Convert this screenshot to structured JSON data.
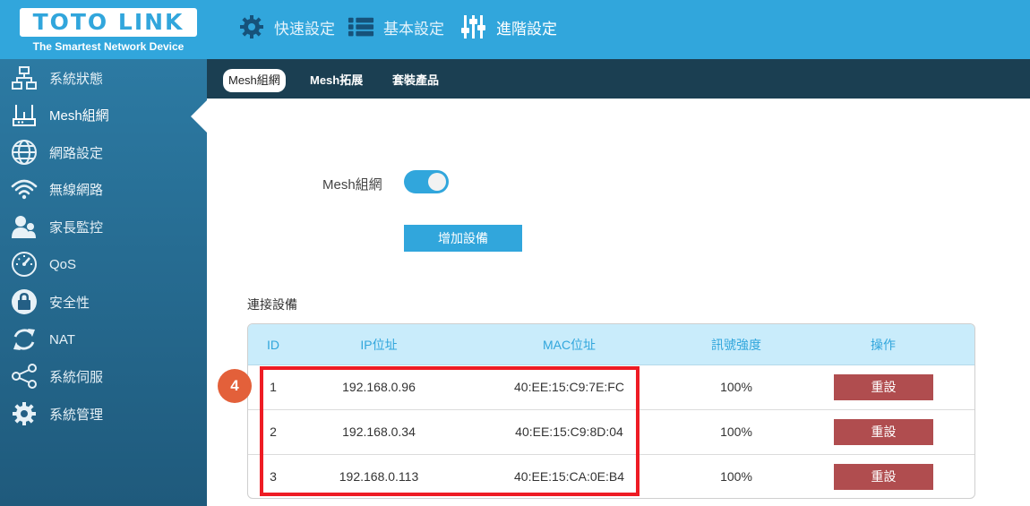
{
  "brand": {
    "logo_text": "TOTO LINK",
    "tagline": "The Smartest Network Device",
    "color_primary": "#31a6dc",
    "color_header_dark": "#1b3f52",
    "color_reset": "#b04d4f"
  },
  "topnav": [
    {
      "label": "快速設定",
      "icon": "gear-icon"
    },
    {
      "label": "基本設定",
      "icon": "list-icon"
    },
    {
      "label": "進階設定",
      "icon": "sliders-icon"
    }
  ],
  "sidebar": {
    "items": [
      {
        "label": "系統狀態",
        "icon": "network-status-icon"
      },
      {
        "label": "Mesh組網",
        "icon": "router-icon",
        "active": true
      },
      {
        "label": "網路設定",
        "icon": "globe-icon"
      },
      {
        "label": "無線網路",
        "icon": "wifi-icon"
      },
      {
        "label": "家長監控",
        "icon": "parental-control-icon"
      },
      {
        "label": "QoS",
        "icon": "speedometer-icon"
      },
      {
        "label": "安全性",
        "icon": "lock-icon"
      },
      {
        "label": "NAT",
        "icon": "refresh-icon"
      },
      {
        "label": "系統伺服",
        "icon": "share-icon"
      },
      {
        "label": "系統管理",
        "icon": "gear-icon"
      }
    ]
  },
  "tabs": [
    {
      "label": "Mesh組網",
      "active": true
    },
    {
      "label": "Mesh拓展",
      "active": false
    },
    {
      "label": "套裝產品",
      "active": false
    }
  ],
  "mesh": {
    "label": "Mesh組網",
    "enabled": true,
    "add_button": "增加設備"
  },
  "devices": {
    "title": "連接設備",
    "columns": [
      "ID",
      "IP位址",
      "MAC位址",
      "訊號強度",
      "操作"
    ],
    "rows": [
      {
        "id": "1",
        "ip": "192.168.0.96",
        "mac": "40:EE:15:C9:7E:FC",
        "signal": "100%",
        "action": "重設"
      },
      {
        "id": "2",
        "ip": "192.168.0.34",
        "mac": "40:EE:15:C9:8D:04",
        "signal": "100%",
        "action": "重設"
      },
      {
        "id": "3",
        "ip": "192.168.0.113",
        "mac": "40:EE:15:CA:0E:B4",
        "signal": "100%",
        "action": "重設"
      }
    ]
  },
  "annotation": {
    "step": "4"
  }
}
